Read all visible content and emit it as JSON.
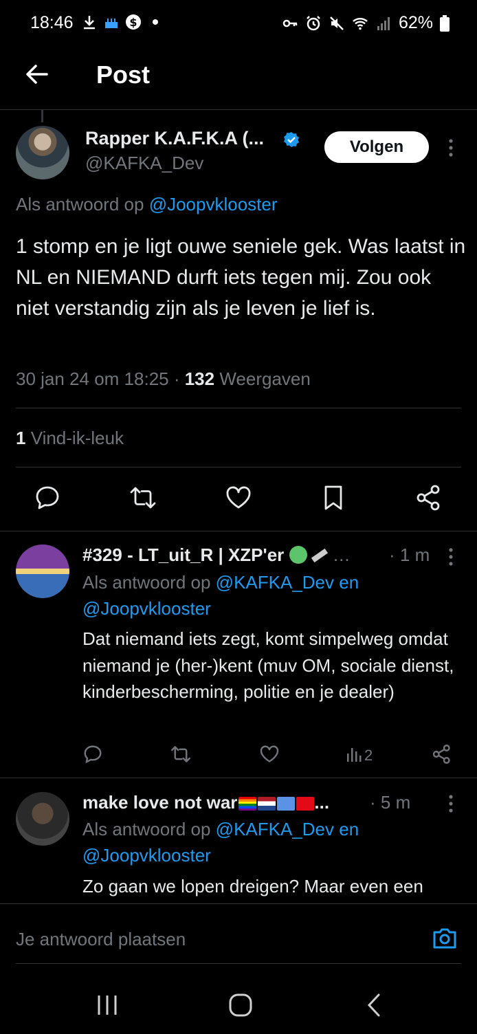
{
  "status_bar": {
    "time": "18:46",
    "battery": "62%"
  },
  "header": {
    "title": "Post"
  },
  "main_post": {
    "author_name": "Rapper K.A.F.K.A (...",
    "author_handle": "@KAFKA_Dev",
    "follow_label": "Volgen",
    "reply_prefix": "Als antwoord op",
    "reply_mention": "@Joopvklooster",
    "text": "1 stomp en je ligt ouwe seniele gek. Was laatst in NL en NIEMAND durft iets tegen mij. Zou ook niet verstandig zijn als je leven je lief is.",
    "date": "30 jan 24 om 18:25 · ",
    "views_count": "132",
    "views_label": " Weergaven",
    "likes_count": "1",
    "likes_label": " Vind-ik-leuk"
  },
  "replies": [
    {
      "author_name": "#329 - LT_uit_R | XZP'er",
      "name_suffix": " …",
      "time": "· 1 m",
      "reply_prefix": "Als antwoord op ",
      "mention_1": "@KAFKA_Dev en",
      "mention_2": "@Joopvklooster",
      "text": "Dat niemand iets zegt, komt simpelweg omdat niemand je (her-)kent (muv OM, sociale dienst, kinderbescherming, politie en je dealer)",
      "views": "2"
    },
    {
      "author_name": "make love not war",
      "name_suffix": "...",
      "time": "· 5 m",
      "reply_prefix": "Als antwoord op ",
      "mention_1": "@KAFKA_Dev en",
      "mention_2": "@Joopvklooster",
      "text": "Zo gaan we lopen dreigen? Maar even een"
    }
  ],
  "composer": {
    "placeholder": "Je antwoord plaatsen"
  },
  "colors": {
    "accent": "#1d9bf0",
    "text_primary": "#e7e9ea",
    "text_secondary": "#71767b",
    "background": "#000000",
    "divider": "#2f3336"
  },
  "icons": {
    "status": [
      "download-icon",
      "cake-icon",
      "dollar-icon",
      "dot-icon",
      "key-icon",
      "alarm-icon",
      "mute-icon",
      "wifi-icon",
      "signal-icon",
      "battery-icon"
    ],
    "actions": [
      "reply-icon",
      "repost-icon",
      "like-icon",
      "bookmark-icon",
      "share-icon"
    ],
    "nav": [
      "recents-icon",
      "home-icon",
      "back-icon"
    ]
  }
}
